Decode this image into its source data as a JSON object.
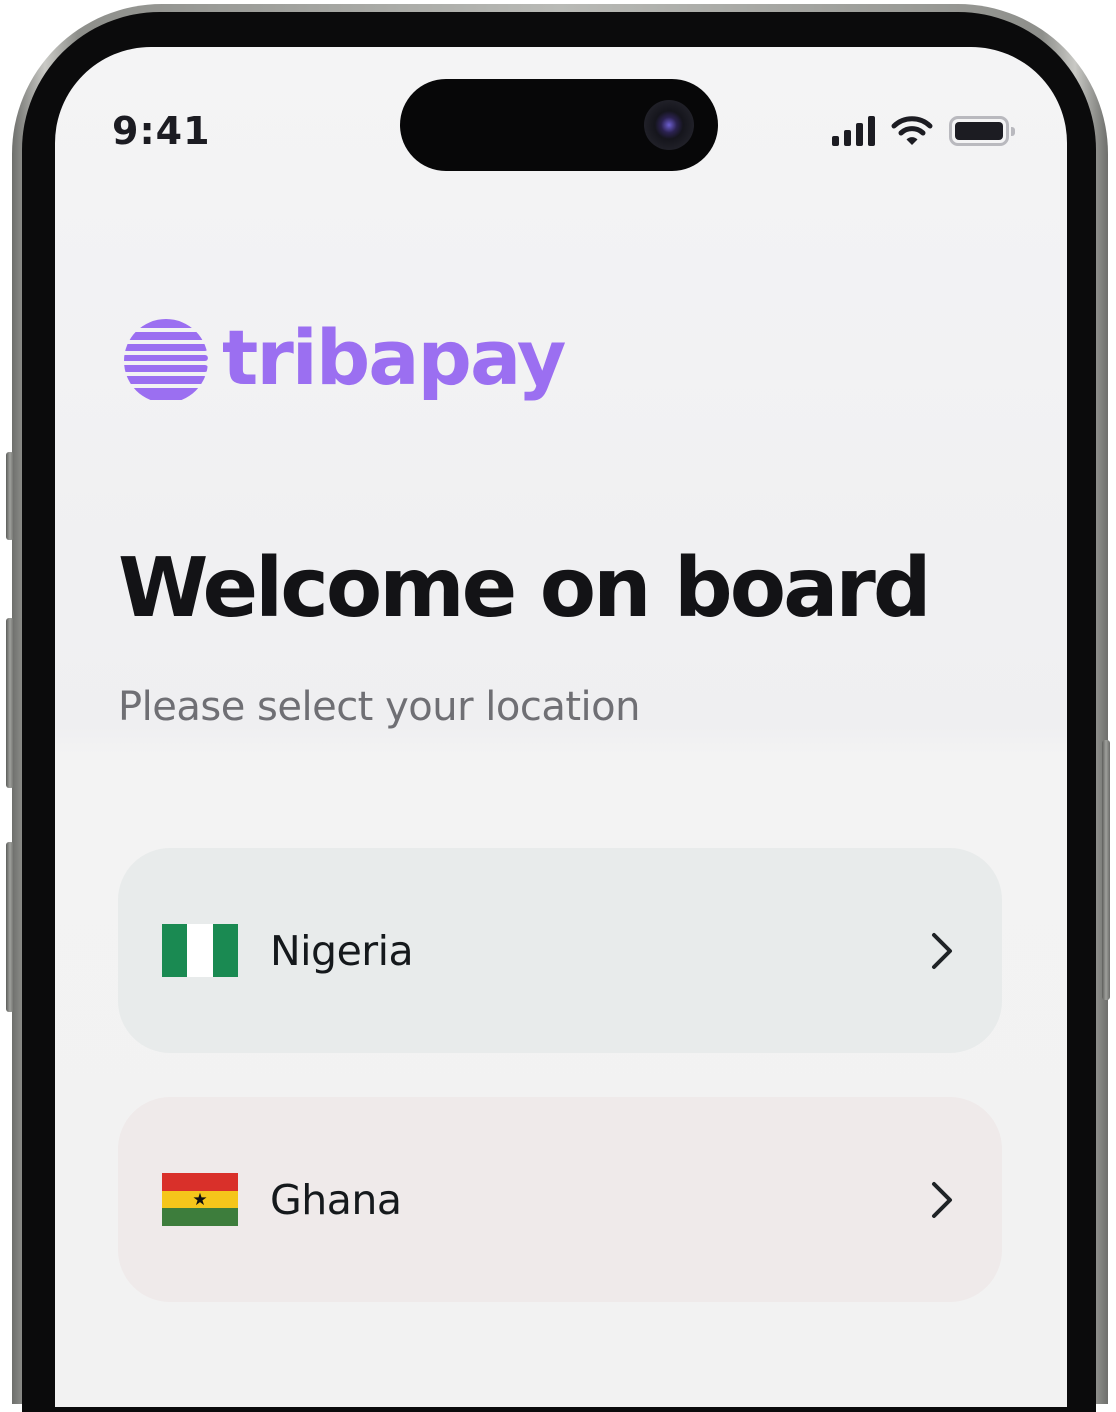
{
  "status_bar": {
    "time": "9:41",
    "icons": [
      "cellular-signal-icon",
      "wifi-icon",
      "battery-icon"
    ]
  },
  "brand": {
    "name": "tribapay",
    "color": "#9b6ff1",
    "icon": "striped-globe-logo-icon"
  },
  "heading": {
    "title": "Welcome on board",
    "subtitle": "Please select your location"
  },
  "countries": [
    {
      "name": "Nigeria",
      "flag": "nigeria-flag-icon",
      "flag_colors": [
        "#1a8a52",
        "#ffffff",
        "#1a8a52"
      ],
      "card_color": "#e8ebeb",
      "action_icon": "chevron-right-icon"
    },
    {
      "name": "Ghana",
      "flag": "ghana-flag-icon",
      "flag_colors": [
        "#d9302a",
        "#f5c61b",
        "#3d7d3c"
      ],
      "card_color": "#efeaea",
      "action_icon": "chevron-right-icon"
    }
  ]
}
